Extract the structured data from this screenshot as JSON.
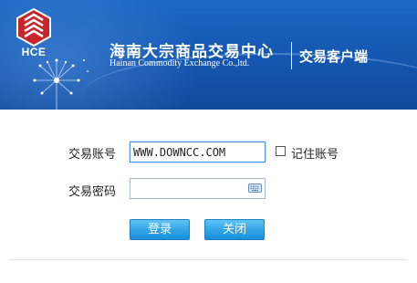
{
  "header": {
    "logo_text": "HCE",
    "title_cn": "海南大宗商品交易中心",
    "title_en": "Hainan Commodity Exchange Co.,ltd.",
    "subtitle": "交易客户端",
    "background_color": "#1456af"
  },
  "form": {
    "account_label": "交易账号",
    "account_value": "WWW.DOWNCC.COM",
    "password_label": "交易密码",
    "password_value": "",
    "remember_label": "记住账号",
    "remember_checked": false,
    "keyboard_icon": "keyboard-icon"
  },
  "buttons": {
    "login_label": "登录",
    "close_label": "关闭",
    "color": "#2fa3e6"
  }
}
